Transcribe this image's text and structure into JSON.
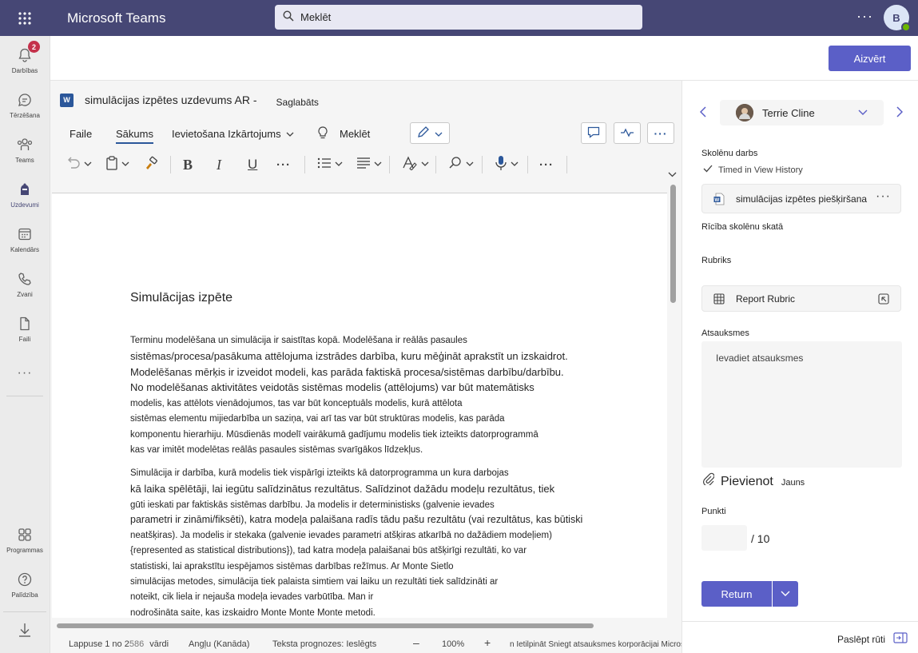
{
  "app": {
    "title": "Microsoft Teams"
  },
  "search": {
    "placeholder": "Meklēt"
  },
  "user": {
    "initial": "B"
  },
  "rail": {
    "items": [
      {
        "label": "Darbības",
        "badge": "2"
      },
      {
        "label": "Tērzēšana"
      },
      {
        "label": "Teams"
      },
      {
        "label": "Uzdevumi"
      },
      {
        "label": "Kalendārs"
      },
      {
        "label": "Zvani"
      },
      {
        "label": "Faili"
      },
      {
        "label": "Programmas"
      },
      {
        "label": "Palīdzība"
      }
    ]
  },
  "close_button": "Aizvērt",
  "word": {
    "doc_name": "simulācijas izpētes uzdevums AR -",
    "saved_status": "Saglabāts",
    "tabs": {
      "file": "Faile",
      "home": "Sākums",
      "insert_layout": "Ievietošana Izkārtojums",
      "search": "Meklēt"
    },
    "document": {
      "heading": "Simulācijas izpēte",
      "lines": [
        "Terminu modelēšana un simulācija ir saistītas kopā. Modelēšana ir reālās pasaules",
        "sistēmas/procesa/pasākuma attēlojuma izstrādes darbība, kuru mēģināt aprakstīt un izskaidrot.",
        "Modelēšanas mērķis ir izveidot modeli, kas parāda faktiskā procesa/sistēmas darbību/darbību.",
        "No modelēšanas aktivitātes veidotās sistēmas modelis (attēlojums) var būt matemātisks",
        "modelis, kas attēlots vienādojumos, tas var būt konceptuāls modelis, kurā attēlota",
        "sistēmas elementu mijiedarbība un saziņa, vai arī tas var būt struktūras modelis, kas parāda",
        "komponentu hierarhiju. Mūsdienās modelī vairākumā gadījumu modelis tiek izteikts datorprogrammā",
        "kas var imitēt modelētas reālās pasaules sistēmas svarīgākos līdzekļus.",
        "Simulācija ir darbība, kurā modelis tiek vispārīgi izteikts kā datorprogramma un kura darbojas",
        "kā laika spēlētāji, lai iegūtu salīdzinātus rezultātus. Salīdzinot dažādu modeļu rezultātus, tiek",
        "gūti ieskati par faktiskās sistēmas darbību. Ja modelis ir deterministisks (galvenie ievades",
        "parametri ir zināmi/fiksēti), katra modeļa palaišana radīs tādu pašu rezultātu (vai rezultātus, kas būtiski",
        "neatšķiras). Ja modelis ir stekaka (galvenie ievades parametri atšķiras atkarībā no dažādiem modeļiem)",
        "{represented as statistical distributions}), tad katra modeļa palaišanai būs atšķirīgi rezultāti, ko var",
        "statistiski, lai aprakstītu iespējamos sistēmas darbības režīmus. Ar Monte Sietlo",
        "simulācijas metodes, simulācija tiek palaista simtiem vai laiku un rezultāti tiek salīdzināti ar",
        "noteikt, cik liela ir nejauša modeļa ievades varbūtība. Man ir",
        "nodrošināta saite, kas izskaidro Monte Monte Monte metodi."
      ]
    },
    "status": {
      "page": "Lappuse 1 no 2",
      "words_num": "586",
      "words_label": "vārdi",
      "language": "Angļu (Kanāda)",
      "prediction": "Teksta prognozes: Ieslēgts",
      "zoom": "100%",
      "feedback": "n Ietilpināt  Sniegt atsauksmes korporācijai Microsoft"
    }
  },
  "panel": {
    "student_name": "Terrie Cline",
    "student_work_label": "Skolēnu darbs",
    "history": "Timed in View History",
    "assignment_file": "simulācijas izpētes piešķiršana",
    "student_view": "Rīcība skolēnu skatā",
    "rubric_label": "Rubriks",
    "rubric_name": "Report Rubric",
    "feedback_label": "Atsauksmes",
    "feedback_placeholder": "Ievadiet atsauksmes",
    "attach_big": "Pievienot",
    "attach_small": "Jauns",
    "points_label": "Punkti",
    "points_max": "/ 10",
    "return_label": "Return",
    "hide_pane": "Paslēpt rūti"
  },
  "colors": {
    "header": "#464775",
    "accent": "#5b5fc7",
    "word_blue": "#2b579a",
    "badge": "#c4314b"
  }
}
